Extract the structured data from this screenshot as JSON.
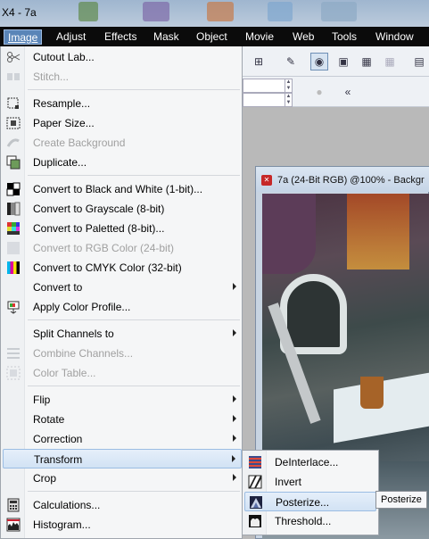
{
  "window": {
    "title": "X4 - 7a"
  },
  "menubar": {
    "items": [
      {
        "label": "Image",
        "active": true
      },
      {
        "label": "Adjust"
      },
      {
        "label": "Effects"
      },
      {
        "label": "Mask"
      },
      {
        "label": "Object"
      },
      {
        "label": "Movie"
      },
      {
        "label": "Web"
      },
      {
        "label": "Tools"
      },
      {
        "label": "Window"
      }
    ]
  },
  "image_menu": {
    "items": [
      {
        "label": "Cutout Lab...",
        "icon": "cutout-lab-icon",
        "enabled": true
      },
      {
        "label": "Stitch...",
        "icon": "stitch-icon",
        "enabled": false
      },
      {
        "label": "Resample...",
        "icon": "resample-icon",
        "enabled": true
      },
      {
        "label": "Paper Size...",
        "icon": "paper-size-icon",
        "enabled": true
      },
      {
        "label": "Create Background",
        "icon": "create-background-icon",
        "enabled": false
      },
      {
        "label": "Duplicate...",
        "icon": "duplicate-icon",
        "enabled": true
      },
      {
        "label": "Convert to Black and White (1-bit)...",
        "icon": "black-white-icon",
        "enabled": true
      },
      {
        "label": "Convert to Grayscale (8-bit)",
        "icon": "grayscale-icon",
        "enabled": true
      },
      {
        "label": "Convert to Paletted (8-bit)...",
        "icon": "paletted-icon",
        "enabled": true
      },
      {
        "label": "Convert to RGB Color (24-bit)",
        "icon": "rgb-icon",
        "enabled": false
      },
      {
        "label": "Convert to CMYK Color (32-bit)",
        "icon": "cmyk-icon",
        "enabled": true
      },
      {
        "label": "Convert to",
        "enabled": true,
        "submenu": true
      },
      {
        "label": "Apply Color Profile...",
        "icon": "color-profile-icon",
        "enabled": true
      },
      {
        "label": "Split Channels to",
        "enabled": true,
        "submenu": true
      },
      {
        "label": "Combine Channels...",
        "icon": "combine-channels-icon",
        "enabled": false
      },
      {
        "label": "Color Table...",
        "icon": "color-table-icon",
        "enabled": false
      },
      {
        "label": "Flip",
        "enabled": true,
        "submenu": true
      },
      {
        "label": "Rotate",
        "enabled": true,
        "submenu": true
      },
      {
        "label": "Correction",
        "enabled": true,
        "submenu": true
      },
      {
        "label": "Transform",
        "enabled": true,
        "submenu": true,
        "highlighted": true
      },
      {
        "label": "Crop",
        "enabled": true,
        "submenu": true
      },
      {
        "label": "Calculations...",
        "icon": "calculations-icon",
        "enabled": true
      },
      {
        "label": "Histogram...",
        "icon": "histogram-icon",
        "enabled": true
      }
    ]
  },
  "transform_submenu": {
    "items": [
      {
        "label": "DeInterlace...",
        "icon": "deinterlace-icon"
      },
      {
        "label": "Invert",
        "icon": "invert-icon"
      },
      {
        "label": "Posterize...",
        "icon": "posterize-icon",
        "highlighted": true
      },
      {
        "label": "Threshold...",
        "icon": "threshold-icon"
      }
    ]
  },
  "tooltip": {
    "text": "Posterize"
  },
  "image_window": {
    "title": "7a (24-Bit RGB) @100% - Backgr"
  }
}
